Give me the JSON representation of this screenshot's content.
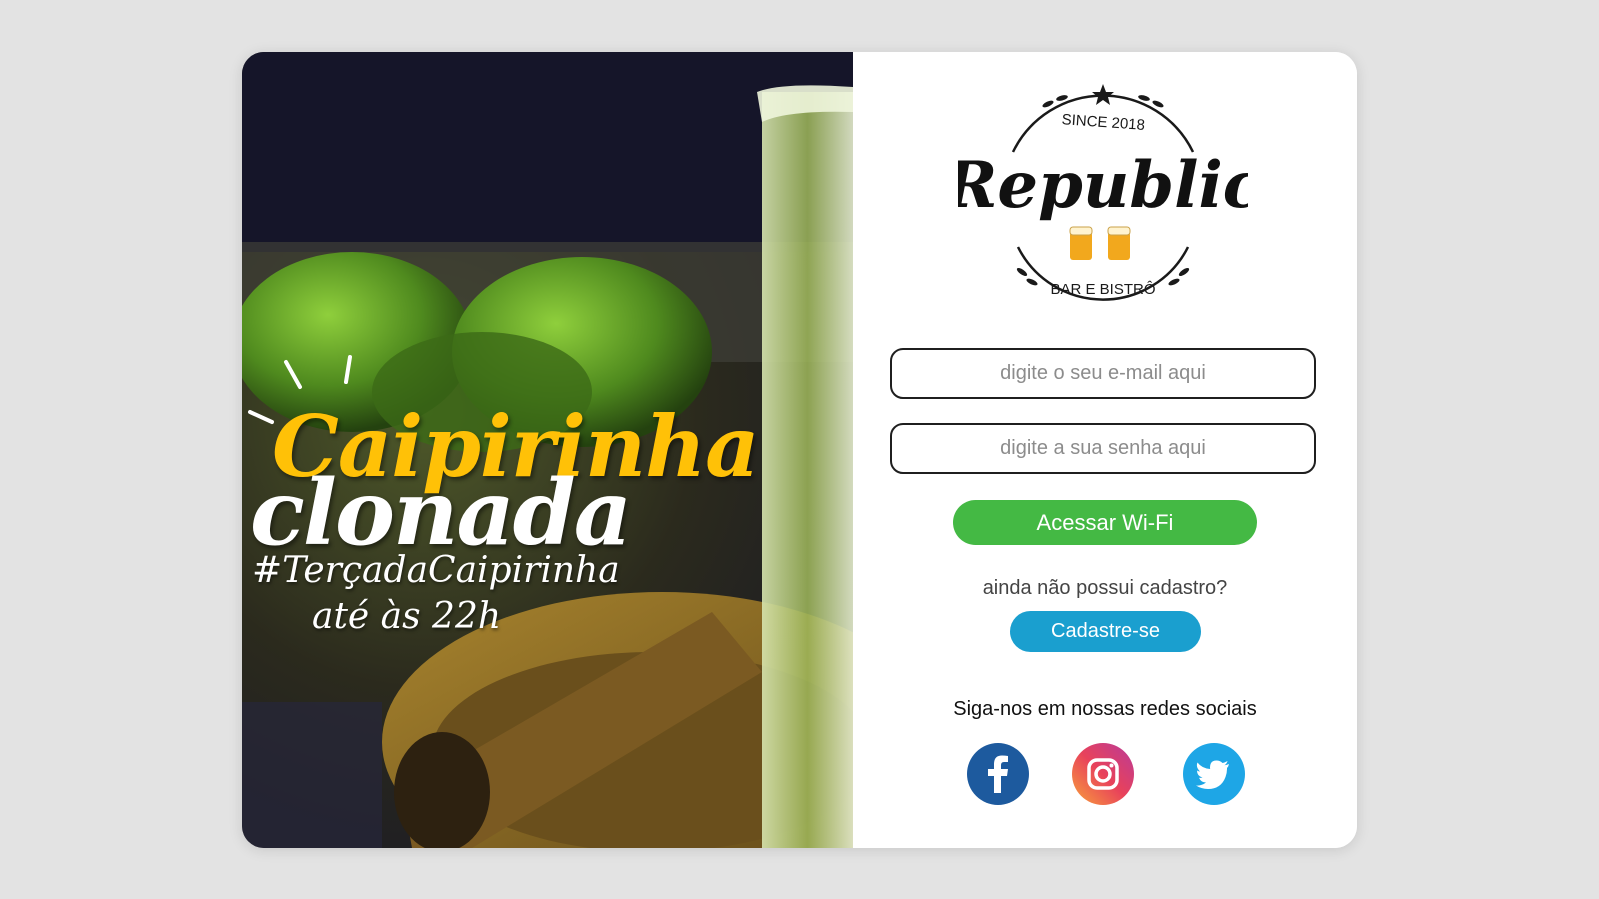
{
  "promo": {
    "headline_line1": "Caipirinha",
    "headline_line2": "clonada",
    "hashtag": "#TerçadaCaipirinha",
    "until": "até às 22h",
    "colors": {
      "headline_accent": "#ffc107",
      "headline_main": "#ffffff"
    }
  },
  "logo": {
    "brand": "Republic",
    "since": "SINCE 2018",
    "subtitle": "BAR E BISTRÔ"
  },
  "login": {
    "email_placeholder": "digite o seu e-mail aqui",
    "email_value": "",
    "password_placeholder": "digite a sua senha aqui",
    "password_value": "",
    "access_button": "Acessar Wi-Fi",
    "signup_question": "ainda não possui cadastro?",
    "signup_button": "Cadastre-se"
  },
  "social": {
    "title": "Siga-nos em nossas redes sociais",
    "networks": [
      {
        "icon": "facebook-icon",
        "color": "#1d5a9e"
      },
      {
        "icon": "instagram-icon",
        "color": "#e8425b"
      },
      {
        "icon": "twitter-icon",
        "color": "#1ea6e6"
      }
    ]
  },
  "colors": {
    "background": "#e3e3e3",
    "access_button": "#44b944",
    "signup_button": "#1a9fcf"
  }
}
